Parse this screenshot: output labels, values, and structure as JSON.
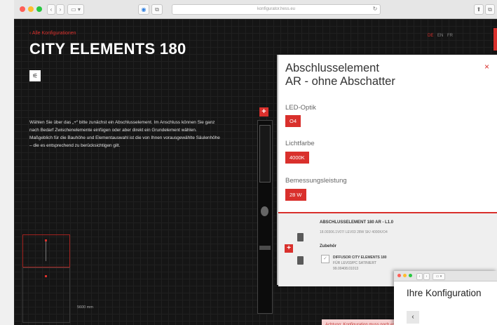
{
  "browser": {
    "url": "konfigurator.hess.eu",
    "nav_back": "‹",
    "nav_forward": "›",
    "sidebar_toggle": "▭ ▾",
    "shield": "◉",
    "refresh": "↻",
    "share": "⬆",
    "tabs": "⧉"
  },
  "page": {
    "breadcrumb": "‹ Alle Konfigurationen",
    "title": "CITY ELEMENTS 180",
    "filter_icon_glyph": "⚟",
    "languages": [
      "DE",
      "EN",
      "FR"
    ],
    "description": "Wählen Sie über das „+“ bitte zunächst ein Abschlusselement. Im Anschluss können Sie ganz nach Bedarf Zwischenelemente einfügen oder aber direkt ein Grundelement wählen. Maßgeblich für die Bauhöhe und Elementauswahl ist die von Ihnen vorausgewählte Säulenhöhe – die es entsprechend zu berücksichtigen gilt.",
    "dimension": "5600 mm",
    "add_glyph": "+",
    "warning": "Achtung: Konfiguration muss noch ergänzt werden"
  },
  "panel": {
    "title_line1": "Abschlusselement",
    "title_line2": "AR - ohne Abschatter",
    "close": "×",
    "led_label": "LED-Optik",
    "led_value": "O4",
    "light_label": "Lichtfarbe",
    "light_value": "4000K",
    "power_label": "Bemessungsleistung",
    "power_value": "28 W",
    "item": {
      "name": "ABSCHLUSSELEMENT 180 AR - L1.0",
      "sub": "18.00306.1V07/ LEV03 28W SK/ 4000K/O4",
      "accessories_label": "Zubehör",
      "add_glyph": "+",
      "accessory_name": "DIFFUSOR CITY ELEMENTS 180",
      "accessory_sub1": "FÜR LEV03/PC SATINIERT",
      "accessory_sub2": "99.00408.01013",
      "check_glyph": "✓"
    }
  },
  "second_window": {
    "title": "Ihre Konfiguration",
    "back": "‹"
  },
  "colors": {
    "accent": "#d9302c",
    "background": "#151515",
    "panel": "#ffffff"
  }
}
